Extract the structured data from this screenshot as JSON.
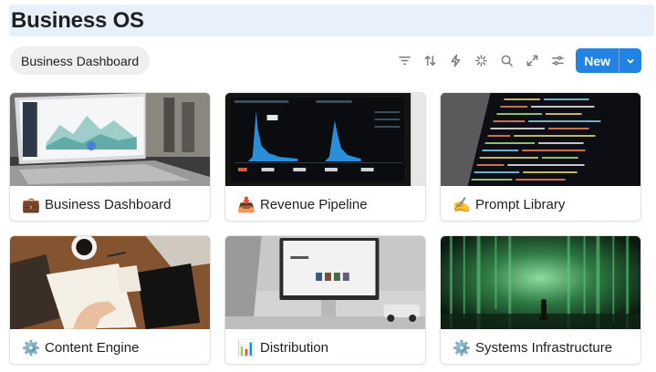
{
  "page": {
    "title": "Business OS"
  },
  "view": {
    "tab_label": "Business Dashboard"
  },
  "toolbar": {
    "icons": [
      "filter-icon",
      "sort-icon",
      "automation-icon",
      "ai-sparkle-icon",
      "search-icon",
      "expand-icon",
      "settings-icon"
    ],
    "new_label": "New"
  },
  "cards": [
    {
      "icon": "💼",
      "title": "Business Dashboard"
    },
    {
      "icon": "📥",
      "title": "Revenue Pipeline"
    },
    {
      "icon": "✍️",
      "title": "Prompt Library"
    },
    {
      "icon": "⚙️",
      "title": "Content Engine"
    },
    {
      "icon": "📊",
      "title": "Distribution"
    },
    {
      "icon": "⚙️",
      "title": "Systems Infrastructure"
    }
  ],
  "colors": {
    "accent": "#2383e2",
    "title_highlight": "#e7f0fb",
    "tab_bg": "#efefed"
  }
}
